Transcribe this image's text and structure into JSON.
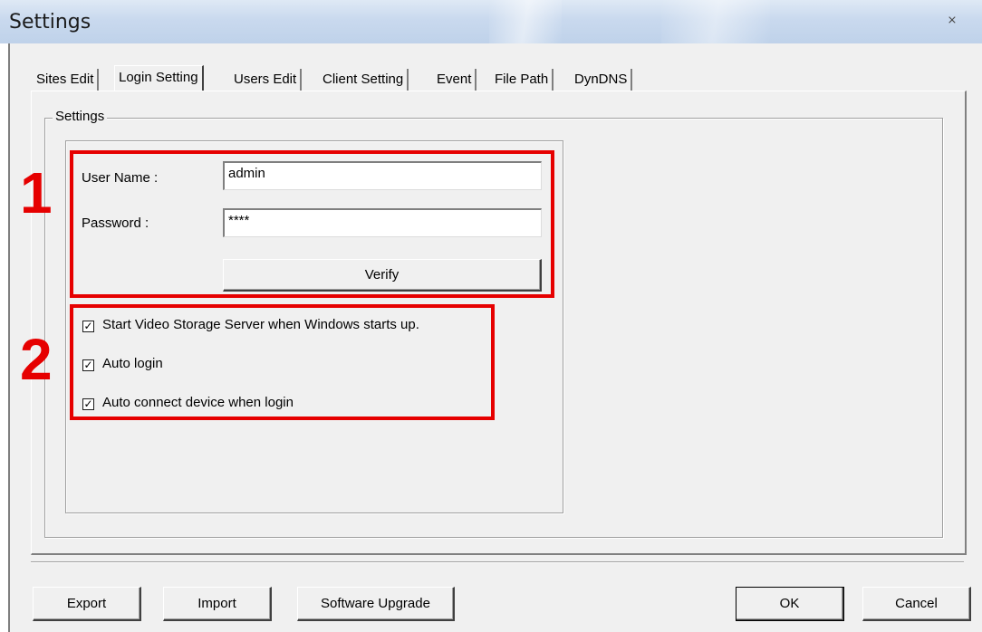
{
  "window": {
    "title": "Settings",
    "close_glyph": "⨯"
  },
  "tabs": [
    {
      "label": "Sites Edit"
    },
    {
      "label": "Login Setting",
      "active": true
    },
    {
      "label": "Users Edit"
    },
    {
      "label": "Client Setting"
    },
    {
      "label": "Event"
    },
    {
      "label": "File Path"
    },
    {
      "label": "DynDNS"
    }
  ],
  "group": {
    "label": "Settings"
  },
  "login": {
    "username_label": "User Name :",
    "username_value": "admin",
    "password_label": "Password :",
    "password_value": "****",
    "verify_label": "Verify"
  },
  "options": [
    {
      "label": "Start Video Storage Server when Windows starts up.",
      "checked": true
    },
    {
      "label": "Auto login",
      "checked": true
    },
    {
      "label": "Auto connect device when login",
      "checked": true
    }
  ],
  "annotations": {
    "one": "1",
    "two": "2",
    "color": "#e60000"
  },
  "footer": {
    "export_label": "Export",
    "import_label": "Import",
    "upgrade_label": "Software Upgrade",
    "ok_label": "OK",
    "cancel_label": "Cancel"
  },
  "check_glyph": "✓"
}
